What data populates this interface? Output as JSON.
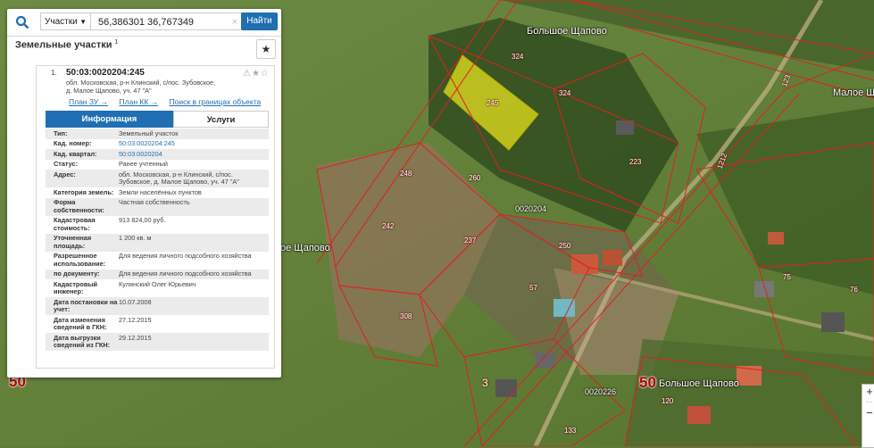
{
  "search": {
    "type_label": "Участки",
    "query": "56,386301 36,767349",
    "find_label": "Найти",
    "clear": "×"
  },
  "panel": {
    "title": "Земельные участки",
    "title_count": "1",
    "star": "★"
  },
  "card": {
    "index": "1.",
    "cadastral_id": "50:03:0020204:245",
    "icons": "⚠★☆",
    "address_line1": "обл. Московская, р-н Клинский, с/пос. Зубовское,",
    "address_line2": "д. Малое Щапово, уч. 47 \"А\"",
    "links": [
      "План ЗУ →",
      "План КК →",
      "Поиск в границах объекта →"
    ],
    "tabs": {
      "info": "Информация",
      "services": "Услуги"
    },
    "rows": [
      {
        "label": "Тип:",
        "value": "Земельный участок",
        "link": false
      },
      {
        "label": "Кад. номер:",
        "value": "50:03:0020204:245",
        "link": true
      },
      {
        "label": "Кад. квартал:",
        "value": "50:03:0020204",
        "link": true
      },
      {
        "label": "Статус:",
        "value": "Ранее учтенный",
        "link": false
      },
      {
        "label": "Адрес:",
        "value": "обл. Московская, р-н Клинский, с/пос. Зубовское, д. Малое Щапово, уч. 47 \"А\"",
        "link": false
      },
      {
        "label": "Категория земель:",
        "value": "Земли населённых пунктов",
        "link": false
      },
      {
        "label": "Форма собственности:",
        "value": "Частная собственность",
        "link": false
      },
      {
        "label": "Кадастровая стоимость:",
        "value": "913 824,00 руб.",
        "link": false
      },
      {
        "label": "Уточненная площадь:",
        "value": "1 200 кв. м",
        "link": false
      },
      {
        "label": "Разрешенное использование:",
        "value": "Для ведения личного подсобного хозяйства",
        "link": false
      },
      {
        "label": "по документу:",
        "value": "Для ведения личного подсобного хозяйства",
        "link": false
      },
      {
        "label": "Кадастровый инженер:",
        "value": "Кулянский Олег Юрьевич",
        "link": false
      },
      {
        "label": "Дата постановки на учет:",
        "value": "10.07.2008",
        "link": false
      },
      {
        "label": "Дата изменения сведений в ГКН:",
        "value": "27.12.2015",
        "link": false
      },
      {
        "label": "Дата выгрузки сведений из ГКН:",
        "value": "29.12.2015",
        "link": false
      }
    ]
  },
  "map": {
    "labels": {
      "bolshoe_top": "Большое Щапово",
      "maloe_right": "Малое Щапо",
      "schapovo_left": "ое Щапово",
      "bolshoe_bottom": "Большое Щапово"
    },
    "region_50_left": "50",
    "region_50_bottom": "50",
    "quarters": {
      "q1": "0020204",
      "q2": "0020226"
    },
    "road_label_1": "1212",
    "road_label_2": "123",
    "parcel_numbers": [
      "324",
      "324",
      "245",
      "223",
      "248",
      "260",
      "242",
      "237",
      "250",
      "57",
      "308",
      "3",
      "75",
      "76",
      "120",
      "133"
    ]
  },
  "zoom": {
    "plus": "+",
    "minus": "−"
  }
}
